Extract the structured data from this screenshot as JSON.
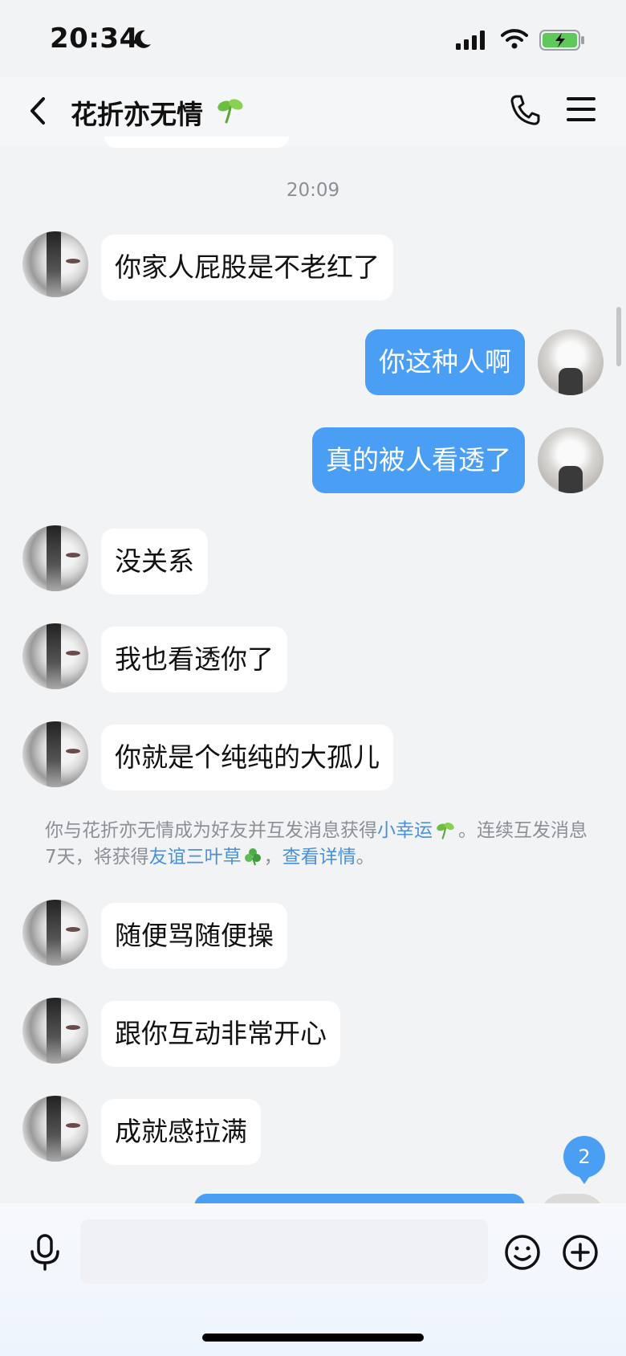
{
  "status_bar": {
    "time": "20:34",
    "icons": [
      "moon-icon",
      "signal-icon",
      "wifi-icon",
      "battery-charging-icon"
    ]
  },
  "header": {
    "title": "花折亦无情",
    "icons": [
      "back-icon",
      "sprout-icon",
      "phone-icon",
      "menu-icon"
    ]
  },
  "chat": {
    "timestamp": "20:09",
    "messages": [
      {
        "from": "other",
        "text": "你家人屁股是不老红了"
      },
      {
        "from": "self",
        "text": "你这种人啊"
      },
      {
        "from": "self",
        "text": "真的被人看透了"
      },
      {
        "from": "other",
        "text": "没关系"
      },
      {
        "from": "other",
        "text": "我也看透你了"
      },
      {
        "from": "other",
        "text": "你就是个纯纯的大孤儿"
      },
      {
        "from": "other",
        "text": "随便骂随便操"
      },
      {
        "from": "other",
        "text": "跟你互动非常开心"
      },
      {
        "from": "other",
        "text": "成就感拉满"
      }
    ],
    "notice": {
      "part1": "你与花折亦无情成为好友并互发消息获得",
      "link1": "小幸运",
      "part2": "。连续互发消息7天，将获得",
      "link2": "友谊三叶草",
      "part3": "，",
      "link3": "查看详情",
      "part4": "。"
    },
    "unread_count": "2"
  },
  "input_bar": {
    "placeholder": "",
    "icons": [
      "mic-icon",
      "emoji-icon",
      "plus-icon"
    ]
  },
  "colors": {
    "accent": "#4a9ff5",
    "background": "#f2f3f5",
    "link": "#4a90d9",
    "muted_text": "#8b8f96",
    "sprout_green": "#6bbf3f"
  }
}
